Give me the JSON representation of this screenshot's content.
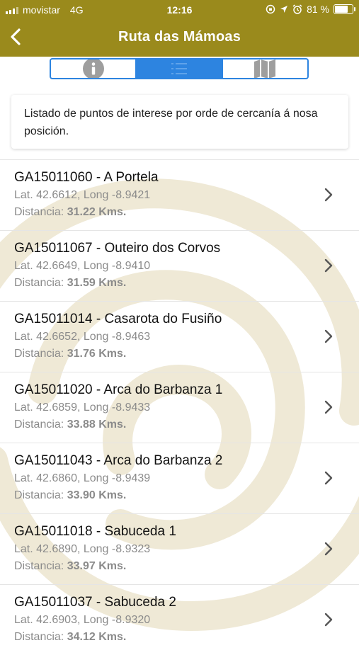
{
  "status_bar": {
    "carrier": "movistar",
    "network": "4G",
    "time": "12:16",
    "battery": "81 %",
    "battery_level": 0.81
  },
  "nav": {
    "title": "Ruta das Mámoas",
    "back_icon": "chevron-left-icon"
  },
  "tabs": [
    {
      "name": "info",
      "icon": "info-icon",
      "active": false
    },
    {
      "name": "list",
      "icon": "list-icon",
      "active": true
    },
    {
      "name": "map",
      "icon": "map-icon",
      "active": false
    }
  ],
  "info_text": "Listado de puntos de interese por orde de cercanía á nosa posición.",
  "items": [
    {
      "title": "GA15011060 - A Portela",
      "coords": "Lat. 42.6612, Long -8.9421",
      "dist_label": "Distancia:",
      "dist_value": "31.22 Kms."
    },
    {
      "title": "GA15011067 - Outeiro dos Corvos",
      "coords": "Lat. 42.6649, Long -8.9410",
      "dist_label": "Distancia:",
      "dist_value": "31.59 Kms."
    },
    {
      "title": "GA15011014 - Casarota do Fusiño",
      "coords": "Lat. 42.6652, Long -8.9463",
      "dist_label": "Distancia:",
      "dist_value": "31.76 Kms."
    },
    {
      "title": "GA15011020 - Arca do Barbanza 1",
      "coords": "Lat. 42.6859, Long -8.9433",
      "dist_label": "Distancia:",
      "dist_value": "33.88 Kms."
    },
    {
      "title": "GA15011043 - Arca do Barbanza 2",
      "coords": "Lat. 42.6860, Long -8.9439",
      "dist_label": "Distancia:",
      "dist_value": "33.90 Kms."
    },
    {
      "title": "GA15011018 - Sabuceda 1",
      "coords": "Lat. 42.6890, Long -8.9323",
      "dist_label": "Distancia:",
      "dist_value": "33.97 Kms."
    },
    {
      "title": "GA15011037 - Sabuceda 2",
      "coords": "Lat. 42.6903, Long -8.9320",
      "dist_label": "Distancia:",
      "dist_value": "34.12 Kms."
    }
  ],
  "colors": {
    "header": "#9a8a1c",
    "accent": "#2d84e0"
  }
}
